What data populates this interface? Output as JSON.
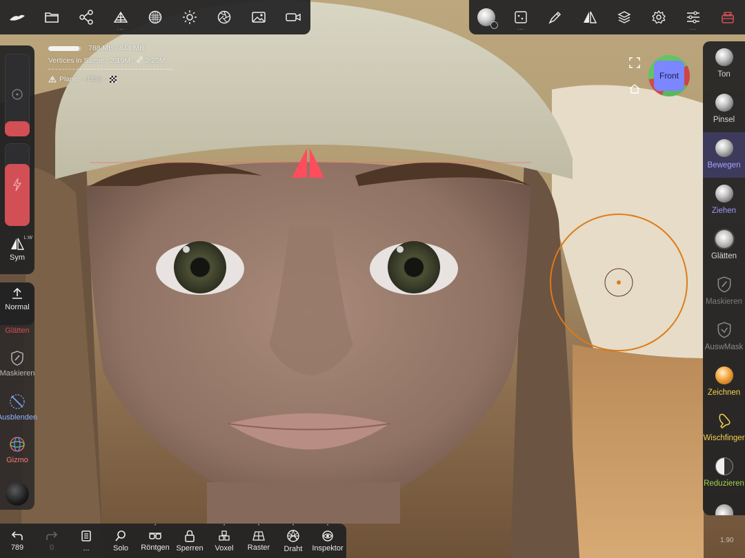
{
  "app": {
    "name": "Nomad Sculpt"
  },
  "top_toolbar_left": {
    "items": [
      {
        "id": "logo",
        "icon": "nomad-logo-icon"
      },
      {
        "id": "files",
        "icon": "folder-icon"
      },
      {
        "id": "scene",
        "icon": "scene-graph-icon"
      },
      {
        "id": "topology",
        "icon": "topology-icon",
        "has_more": true,
        "more": "..."
      },
      {
        "id": "material",
        "icon": "material-sphere-icon"
      },
      {
        "id": "light",
        "icon": "sun-icon"
      },
      {
        "id": "postprocess",
        "icon": "aperture-icon"
      },
      {
        "id": "background",
        "icon": "image-icon"
      },
      {
        "id": "record",
        "icon": "video-camera-icon"
      }
    ]
  },
  "top_toolbar_right": {
    "items": [
      {
        "id": "material-preview",
        "icon": "matcap-sphere-icon"
      },
      {
        "id": "stroke",
        "icon": "stroke-icon",
        "has_more": true,
        "more": "..."
      },
      {
        "id": "tool-settings",
        "icon": "brush-pen-icon"
      },
      {
        "id": "symmetry",
        "icon": "symmetry-icon"
      },
      {
        "id": "layers",
        "icon": "layers-icon"
      },
      {
        "id": "settings",
        "icon": "gear-icon"
      },
      {
        "id": "interface",
        "icon": "sliders-icon",
        "has_more": true,
        "more": "..."
      },
      {
        "id": "mascot",
        "icon": "robot-icon"
      }
    ]
  },
  "info": {
    "memory": "788 MB / 844 MB",
    "memory_ratio": 0.93,
    "vertices_label": "Vertices in Szene :",
    "vertices_value": "2.19M",
    "vertices_linked": "2.20M",
    "mesh_name": "Plane",
    "mesh_count": "4356"
  },
  "left_panel": {
    "sym_label": "Sym",
    "sym_badge": "L:W",
    "normal_label": "Normal",
    "radius_value": 0.18,
    "intensity_value": 0.75
  },
  "left_tools": [
    {
      "label": "Glätten",
      "icon": "smooth-icon",
      "color": "#d24f55"
    },
    {
      "label": "Maskieren",
      "icon": "mask-shield-icon",
      "color": "#b9b9b9"
    },
    {
      "label": "Ausblenden",
      "icon": "hide-grid-icon",
      "color": "#8fb4ff"
    },
    {
      "label": "Gizmo",
      "icon": "gizmo-icon",
      "color": "#ff7a7a"
    }
  ],
  "right_tools": [
    {
      "label": "Ton",
      "icon": "clay-sphere-icon",
      "color": "#d8d8d8",
      "active": false
    },
    {
      "label": "Pinsel",
      "icon": "brush-sphere-icon",
      "color": "#d8d8d8",
      "active": false
    },
    {
      "label": "Bewegen",
      "icon": "move-sphere-icon",
      "color": "#a9a2ff",
      "active": true
    },
    {
      "label": "Ziehen",
      "icon": "drag-sphere-icon",
      "color": "#9f99ff",
      "active": false
    },
    {
      "label": "Glätten",
      "icon": "smooth-sphere-icon",
      "color": "#d8d8d8",
      "active": false
    },
    {
      "label": "Maskieren",
      "icon": "mask-shield-icon",
      "color": "#7d7d7d",
      "active": false
    },
    {
      "label": "AuswMask",
      "icon": "selmask-shield-icon",
      "color": "#8a8a8a",
      "active": false
    },
    {
      "label": "Zeichnen",
      "icon": "paint-sphere-icon",
      "color": "#f4d24c",
      "active": false
    },
    {
      "label": "Wischfinger",
      "icon": "smudge-finger-icon",
      "color": "#f4d24c",
      "active": false
    },
    {
      "label": "Reduzieren",
      "icon": "decimate-sphere-icon",
      "color": "#9fd44c",
      "active": false
    }
  ],
  "bottom_toolbar": [
    {
      "id": "undo",
      "label": "789",
      "icon": "undo-icon"
    },
    {
      "id": "redo",
      "label": "0",
      "icon": "redo-icon"
    },
    {
      "id": "history",
      "label": "...",
      "icon": "book-icon"
    },
    {
      "id": "solo",
      "label": "Solo",
      "icon": "magnifier-icon"
    },
    {
      "id": "xray",
      "label": "Röntgen",
      "icon": "glasses-icon",
      "dot": "•"
    },
    {
      "id": "lock",
      "label": "Sperren",
      "icon": "lock-icon"
    },
    {
      "id": "voxel",
      "label": "Voxel",
      "icon": "voxel-icon",
      "dot": "•"
    },
    {
      "id": "grid",
      "label": "Raster",
      "icon": "grid-icon",
      "dot": "•"
    },
    {
      "id": "wire",
      "label": "Draht",
      "icon": "wireframe-icon",
      "dot": "•"
    },
    {
      "id": "inspector",
      "label": "Inspektor",
      "icon": "eye-icon",
      "dot": "•"
    }
  ],
  "view_cube": {
    "face": "Front"
  },
  "zoom": "1.90"
}
